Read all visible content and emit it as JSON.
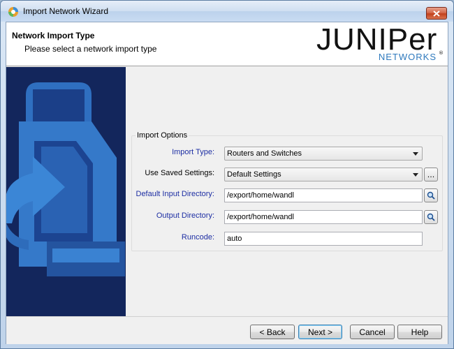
{
  "window": {
    "title": "Import Network Wizard"
  },
  "header": {
    "title": "Network Import Type",
    "subtitle": "Please select a network import type",
    "logo_main": "JUNIPer",
    "logo_sub": "NETWORKS",
    "logo_mark": "®"
  },
  "options": {
    "legend": "Import Options",
    "import_type": {
      "label": "Import Type:",
      "value": "Routers and Switches"
    },
    "saved_settings": {
      "label": "Use Saved Settings:",
      "value": "Default Settings",
      "browse": "..."
    },
    "input_dir": {
      "label": "Default Input Directory:",
      "value": "/export/home/wandl"
    },
    "output_dir": {
      "label": "Output Directory:",
      "value": "/export/home/wandl"
    },
    "runcode": {
      "label": "Runcode:",
      "value": "auto"
    }
  },
  "footer": {
    "back": "< Back",
    "next": "Next >",
    "cancel": "Cancel",
    "help": "Help"
  },
  "colors": {
    "side_panel": "#13265c",
    "label_blue": "#1d2ea3",
    "logo_blue": "#2e79bd"
  }
}
